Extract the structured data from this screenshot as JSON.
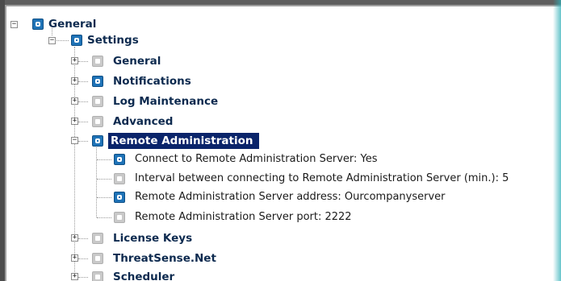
{
  "tree": {
    "root": {
      "label": "General",
      "expanded": true,
      "checked": true
    },
    "settings": {
      "label": "Settings",
      "expanded": true,
      "checked": true
    },
    "children": [
      {
        "label": "General",
        "checked": false
      },
      {
        "label": "Notifications",
        "checked": true
      },
      {
        "label": "Log Maintenance",
        "checked": false
      },
      {
        "label": "Advanced",
        "checked": false
      }
    ],
    "remote_admin": {
      "label": "Remote Administration",
      "checked": true,
      "selected": true,
      "items": [
        {
          "label": "Connect to Remote Administration Server: Yes",
          "checked": true
        },
        {
          "label": "Interval between connecting to Remote Administration Server (min.): 5",
          "checked": false
        },
        {
          "label": "Remote Administration Server address: Ourcompanyserver",
          "checked": true
        },
        {
          "label": "Remote Administration Server port: 2222",
          "checked": false
        }
      ]
    },
    "after": [
      {
        "label": "License Keys",
        "checked": false
      },
      {
        "label": "ThreatSense.Net",
        "checked": false
      },
      {
        "label": "Scheduler",
        "checked": false
      }
    ],
    "toggle_symbols": {
      "expanded": "−",
      "collapsed": "+"
    }
  },
  "colors": {
    "selection": "#0a246a",
    "checkbox_on": "#1f73b7",
    "checkbox_off": "#c9c9c9",
    "label_text": "#0d2a4f",
    "accent_glow": "#30b0b8"
  }
}
